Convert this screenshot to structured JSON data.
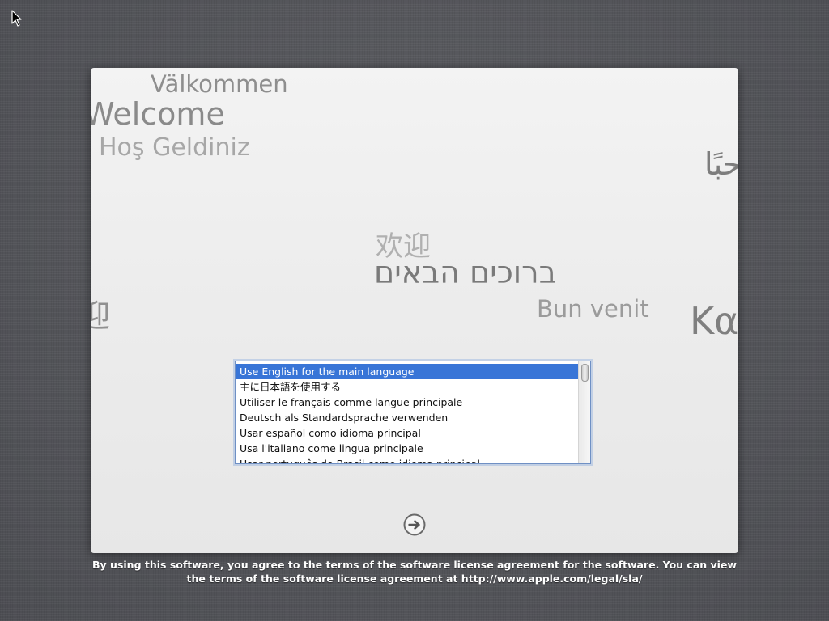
{
  "greetings": {
    "valkommen": "Välkommen",
    "welcome": "Welcome",
    "hos_geldiniz": "Hoş Geldiniz",
    "arabic": "مرحبًا",
    "chinese": "欢迎",
    "hebrew": "ברוכים הבאים",
    "bun_venit": "Bun venit",
    "greek": "Καλώς",
    "left_partial": "迎"
  },
  "language_list": {
    "items": [
      {
        "label": "Use English for the main language",
        "selected": true
      },
      {
        "label": "主に日本語を使用する",
        "selected": false
      },
      {
        "label": "Utiliser le français comme langue principale",
        "selected": false
      },
      {
        "label": "Deutsch als Standardsprache verwenden",
        "selected": false
      },
      {
        "label": "Usar español como idioma principal",
        "selected": false
      },
      {
        "label": "Usa l'italiano come lingua principale",
        "selected": false
      },
      {
        "label": "Usar português do Brasil como idioma principal",
        "selected": false
      }
    ]
  },
  "icons": {
    "next": "arrow-right-circle-icon",
    "cursor": "mouse-pointer-icon"
  },
  "license": {
    "line1": "By using this software, you agree to the terms of the software license agreement for the software. You can view",
    "line2": "the terms of the software license agreement at http://www.apple.com/legal/sla/"
  },
  "colors": {
    "selection": "#3875d7",
    "focus_ring": "#6f90c4"
  }
}
